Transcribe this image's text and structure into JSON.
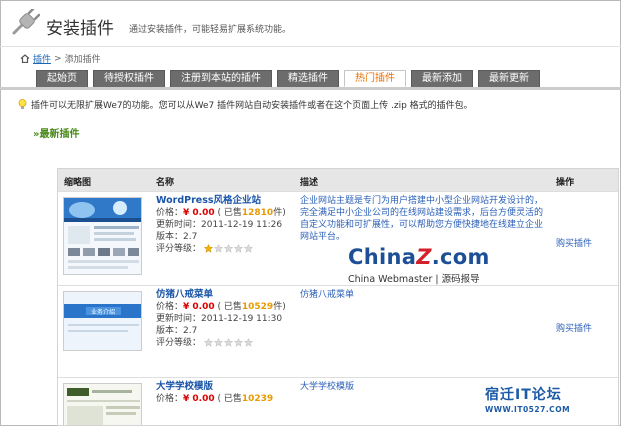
{
  "header": {
    "title": "安装插件",
    "subtitle": "通过安装插件，可能轻易扩展系统功能。"
  },
  "breadcrumb": {
    "home": "插件",
    "separator": ">",
    "current": "添加插件"
  },
  "tabs": [
    {
      "label": "起始页",
      "active": false
    },
    {
      "label": "待授权插件",
      "active": false
    },
    {
      "label": "注册到本站的插件",
      "active": false
    },
    {
      "label": "精选插件",
      "active": false
    },
    {
      "label": "热门插件",
      "active": true
    },
    {
      "label": "最新添加",
      "active": false
    },
    {
      "label": "最新更新",
      "active": false
    }
  ],
  "tip": "插件可以无限扩展We7的功能。您可以从We7 插件网站自动安装插件或者在这个页面上传 .zip 格式的插件包。",
  "section_title": "»最新插件",
  "table": {
    "headers": [
      "缩略图",
      "名称",
      "描述",
      "操作"
    ],
    "rows": [
      {
        "name": "WordPress风格企业站",
        "price_label": "价格：",
        "price": "¥ 0.00",
        "sold_prefix": "( 已售",
        "sold": "12810",
        "sold_suffix": "件)",
        "updated": "更新时间：2011-12-19 11:26",
        "version": "版本：2.7",
        "rating_label": "评分等级：",
        "rating": 1,
        "description": "企业网站主题是专门为用户搭建中小型企业网站开发设计的，完全满足中小企业公司的在线网站建设需求，后台方便灵活的自定义功能和可扩展性，可以帮助您方便快捷地在线建立企业网站平台。",
        "action": "购买插件"
      },
      {
        "name": "仿猪八戒菜单",
        "price_label": "价格：",
        "price": "¥ 0.00",
        "sold_prefix": "( 已售",
        "sold": "10529",
        "sold_suffix": "件)",
        "updated": "更新时间：2011-12-19 11:30",
        "version": "版本：2.7",
        "rating_label": "评分等级：",
        "rating": 0,
        "description": "仿猪八戒菜单",
        "action": "购买插件"
      },
      {
        "name": "大学学校模版",
        "price_label": "价格：",
        "price": "¥ 0.00",
        "sold_prefix": "( 已售",
        "sold": "10239",
        "sold_suffix": "",
        "updated": "",
        "version": "",
        "rating_label": "",
        "rating": 0,
        "description": "大学学校模版",
        "action": ""
      }
    ]
  },
  "watermark_center": {
    "logo_a": "China",
    "logo_z": "Z",
    "logo_b": ".com",
    "line": "China Webmaster | 源码报导"
  },
  "watermark_corner": {
    "text": "宿迁IT论坛",
    "url": "WWW.IT0527.COM"
  },
  "icons": [
    "plug-icon",
    "home-icon",
    "bulb-icon",
    "star-icon"
  ]
}
